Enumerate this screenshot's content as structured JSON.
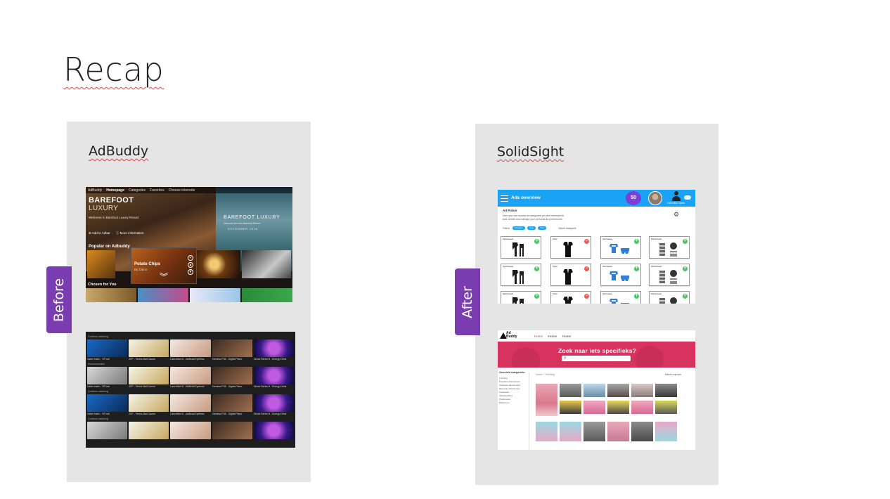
{
  "slide": {
    "title": "Recap"
  },
  "left": {
    "heading": "AdBuddy",
    "tag": "Before",
    "home": {
      "nav": [
        "AdBuddy",
        "Homepage",
        "Categories",
        "Favorites",
        "Choose interests"
      ],
      "hero_title": "BAREFOOT",
      "hero_subtitle": "LUXURY",
      "hero_desc": "Welcome to Barefoot Luxury Resort",
      "add_label": "Add to Adbar",
      "info_label": "More information",
      "right_title": "BAREFOOT LUXURY",
      "right_sub": "Discover the new Barefoot Resort",
      "right_date": "DECEMBER 2018",
      "row_title": "Popular on Adbuddy",
      "popup_title": "Potato Chips",
      "popup_by": "By Dlano",
      "row2_title": "Chosen for You"
    },
    "grid": {
      "sections": [
        "Continue watching",
        "Recommended",
        "Continue watching"
      ],
      "captions": [
        "Valve Index - VR set",
        "ATP - Tennis Ball Canon",
        "Lanceline III - Artificial Eyelinss",
        "Yamaha P45 - Digital Piano",
        "Ghost Series 8 - Energy Drink"
      ]
    }
  },
  "right": {
    "heading": "SolidSight",
    "tag": "After",
    "ads": {
      "title": "Ads overview",
      "points": "50",
      "user_name": "Gebruiker naam",
      "picker_title": "Ad Picker",
      "picker_desc_1": "Here you can choose all categories you are interested in.",
      "picker_desc_2": "Add, delete and manage your personal ad preferences.",
      "filter_label": "Filters:",
      "chips": [
        "Category",
        "Type",
        "New"
      ],
      "select_label": "Select categorie:",
      "cards": [
        {
          "label": "Sportswear",
          "state": "add",
          "kind": "tracksuit"
        },
        {
          "label": "Suits",
          "state": "remove",
          "kind": "suit"
        },
        {
          "label": "Swimwear",
          "state": "add",
          "kind": "swim"
        },
        {
          "label": "Winterwear",
          "state": "add",
          "kind": "winter"
        },
        {
          "label": "Sportswear",
          "state": "add",
          "kind": "tracksuit"
        },
        {
          "label": "Suits",
          "state": "remove",
          "kind": "suit"
        },
        {
          "label": "Swimwear",
          "state": "add",
          "kind": "swim"
        },
        {
          "label": "Winterwear",
          "state": "add",
          "kind": "winter"
        },
        {
          "label": "Sportswear",
          "state": "add",
          "kind": "tracksuit"
        },
        {
          "label": "Suits",
          "state": "remove",
          "kind": "suit"
        },
        {
          "label": "Swimwear",
          "state": "add",
          "kind": "swim"
        },
        {
          "label": "Winterwear",
          "state": "add",
          "kind": "winter"
        }
      ],
      "colors": {
        "accent": "#1aa3f5",
        "points": "#7b3ed6",
        "add": "#4fc463",
        "remove": "#ee5a4f"
      }
    },
    "adbuddy_new": {
      "logo": "Ad Buddy",
      "nav": [
        "Home",
        "Home",
        "Home"
      ],
      "banner_title": "Zoek naar iets specifieks?",
      "sidebar_title": "Overzicht categorieën",
      "sidebar_items": [
        "Trending",
        "Populaire advertenties",
        "Categorie advertenties",
        "Nieuwste advertenties",
        "Favorieten",
        "Videobeelding",
        "Preferences",
        "Platformen"
      ],
      "breadcrumb": "Home > Trending",
      "sort": "Meest populair",
      "colors": {
        "brand": "#d8335f"
      }
    }
  }
}
